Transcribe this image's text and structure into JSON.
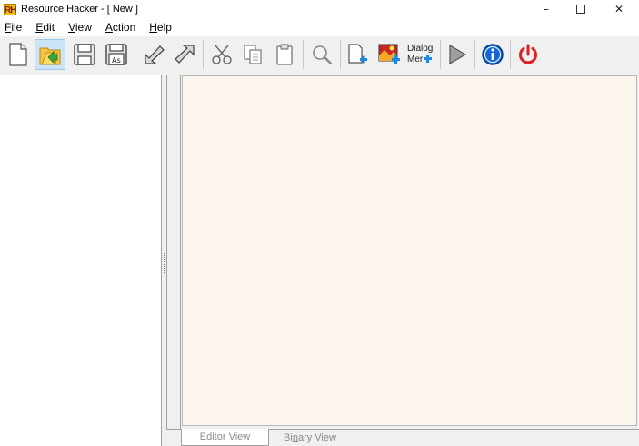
{
  "window": {
    "app_icon_text": "RH",
    "title": "Resource Hacker - [ New ]",
    "controls": {
      "minimize": "–",
      "close": "✕"
    }
  },
  "menu": [
    {
      "accel": "F",
      "rest": "ile"
    },
    {
      "accel": "E",
      "rest": "dit"
    },
    {
      "accel": "V",
      "rest": "iew"
    },
    {
      "accel": "A",
      "rest": "ction"
    },
    {
      "accel": "H",
      "rest": "elp"
    }
  ],
  "toolbar": {
    "save_as_badge": "As",
    "dialog_menu_top": "Dialog",
    "dialog_menu_bottom": "Mer",
    "icons": [
      "new-file",
      "open-folder",
      "save",
      "save-as",
      "compile",
      "extract",
      "cut",
      "copy",
      "paste",
      "find",
      "add-resource",
      "add-image-resource",
      "dialog-merge",
      "run-script",
      "about",
      "exit"
    ]
  },
  "tabs": {
    "editor": {
      "accel": "E",
      "pre": "",
      "rest": "ditor View"
    },
    "binary": {
      "pre": "Bi",
      "accel": "n",
      "rest": "ary View"
    }
  },
  "colors": {
    "editor_background": "#fdf6ef",
    "accent_red": "#e02020",
    "info_blue": "#1466d4"
  }
}
